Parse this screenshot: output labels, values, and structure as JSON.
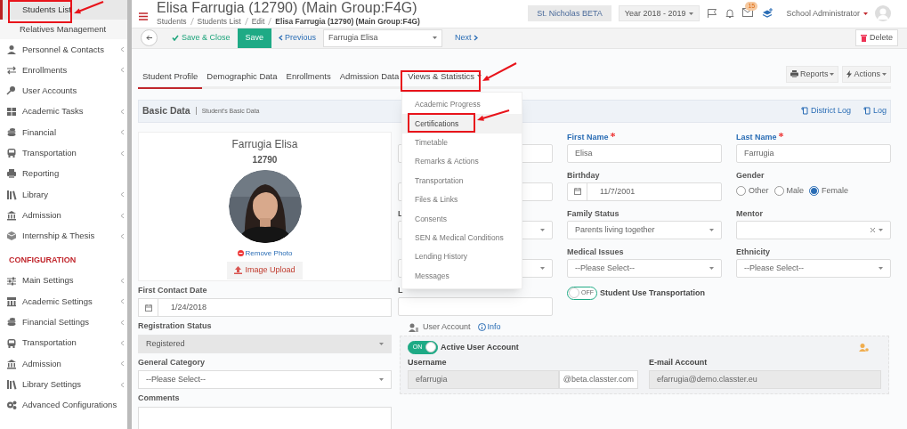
{
  "sidebar": {
    "sub_items": [
      {
        "label": "Students List",
        "selected": true
      },
      {
        "label": "Relatives Management",
        "selected": false
      }
    ],
    "items": [
      {
        "label": "Personnel & Contacts",
        "kind": "person",
        "expandable": true
      },
      {
        "label": "Enrollments",
        "kind": "arrows",
        "expandable": true
      },
      {
        "label": "User Accounts",
        "kind": "key",
        "expandable": false
      },
      {
        "label": "Academic Tasks",
        "kind": "grid",
        "expandable": true
      },
      {
        "label": "Financial",
        "kind": "coins",
        "expandable": true
      },
      {
        "label": "Transportation",
        "kind": "bus",
        "expandable": true
      },
      {
        "label": "Reporting",
        "kind": "printer",
        "expandable": false
      },
      {
        "label": "Library",
        "kind": "books",
        "expandable": true
      },
      {
        "label": "Admission",
        "kind": "bank",
        "expandable": true
      },
      {
        "label": "Internship & Thesis",
        "kind": "box",
        "expandable": true
      }
    ],
    "section_title": "CONFIGURATION",
    "config_items": [
      {
        "label": "Main Settings",
        "kind": "sliders",
        "expandable": true
      },
      {
        "label": "Academic Settings",
        "kind": "chart",
        "expandable": true
      },
      {
        "label": "Financial Settings",
        "kind": "coins",
        "expandable": true
      },
      {
        "label": "Transportation",
        "kind": "bus",
        "expandable": true
      },
      {
        "label": "Admission",
        "kind": "bank",
        "expandable": true
      },
      {
        "label": "Library Settings",
        "kind": "books",
        "expandable": true
      },
      {
        "label": "Advanced Configurations",
        "kind": "gears",
        "expandable": false
      }
    ]
  },
  "header": {
    "title": "Elisa Farrugia (12790) (Main Group:F4G)",
    "breadcrumbs": [
      "Students",
      "Students List",
      "Edit",
      "Elisa Farrugia (12790) (Main Group:F4G)"
    ],
    "school": "St. Nicholas BETA",
    "year": "Year 2018 - 2019",
    "mail_count": "15",
    "user": "School Administrator"
  },
  "toolbar": {
    "save_close": "Save & Close",
    "save": "Save",
    "previous": "Previous",
    "student": "Farrugia Elisa",
    "next": "Next",
    "delete": "Delete"
  },
  "tabs": [
    {
      "label": "Student Profile",
      "selected": true,
      "dropdown": false
    },
    {
      "label": "Demographic Data",
      "selected": false,
      "dropdown": false
    },
    {
      "label": "Enrollments",
      "selected": false,
      "dropdown": false
    },
    {
      "label": "Admission Data",
      "selected": false,
      "dropdown": false
    },
    {
      "label": "Views & Statistics",
      "selected": false,
      "dropdown": true
    }
  ],
  "tab_actions": [
    "Reports",
    "Actions"
  ],
  "dropdown_menu": [
    {
      "label": "Academic Progress",
      "selected": false
    },
    {
      "label": "Certifications",
      "selected": true
    },
    {
      "label": "Timetable",
      "selected": false
    },
    {
      "label": "Remarks & Actions",
      "selected": false
    },
    {
      "label": "Transportation",
      "selected": false
    },
    {
      "label": "Files & Links",
      "selected": false
    },
    {
      "label": "Consents",
      "selected": false
    },
    {
      "label": "SEN & Medical Conditions",
      "selected": false
    },
    {
      "label": "Lending History",
      "selected": false
    },
    {
      "label": "Messages",
      "selected": false
    }
  ],
  "section": {
    "title": "Basic Data",
    "subtitle": "Student's Basic Data",
    "links": [
      "District Log",
      "Log"
    ]
  },
  "profile": {
    "name": "Farrugia Elisa",
    "id": "12790",
    "remove": "Remove Photo",
    "upload": "Image Upload"
  },
  "left_fields": [
    {
      "label": "First Contact Date",
      "kind": "date",
      "value": "1/24/2018"
    },
    {
      "label": "Registration Status",
      "kind": "select",
      "value": "Registered",
      "disabled": true
    },
    {
      "label": "General Category",
      "kind": "select",
      "value": "--Please Select--",
      "disabled": false
    },
    {
      "label": "Comments",
      "kind": "textarea"
    }
  ],
  "grid_fields": [
    {
      "kind": "text"
    },
    {
      "label": "First Name",
      "kind": "text",
      "value": "Elisa",
      "required": true
    },
    {
      "label": "Last Name",
      "kind": "text",
      "value": "Farrugia",
      "required": true
    },
    {
      "kind": "text"
    },
    {
      "label": "Birthday",
      "kind": "date",
      "value": "11/7/2001",
      "required": false
    },
    {
      "label": "Gender",
      "kind": "radio",
      "required": false,
      "options": [
        {
          "label": "Other",
          "selected": false
        },
        {
          "label": "Male",
          "selected": false
        },
        {
          "label": "Female",
          "selected": true
        }
      ]
    },
    {
      "label": "L",
      "kind": "select",
      "required": false
    },
    {
      "label": "Family Status",
      "kind": "select",
      "value": "Parents living together",
      "required": false
    },
    {
      "label": "Mentor",
      "kind": "select",
      "clearable": true,
      "required": false
    },
    {
      "kind": "select"
    },
    {
      "label": "Medical Issues",
      "kind": "select",
      "value": "--Please Select--",
      "required": false
    },
    {
      "label": "Ethnicity",
      "kind": "select",
      "value": "--Please Select--",
      "required": false
    },
    {
      "label": "L",
      "kind": "text",
      "required": false
    },
    {
      "label": "Student Use Transportation",
      "kind": "toggle",
      "on": false,
      "toggle_text": "OFF"
    }
  ],
  "user_account": {
    "title": "User Account",
    "info": "Info",
    "active_label": "Active User Account",
    "active": true,
    "toggle_text": "ON",
    "username_label": "Username",
    "username": "efarrugia",
    "domain": "@beta.classter.com",
    "email_label": "E-mail Account",
    "email": "efarrugia@demo.classter.eu"
  }
}
